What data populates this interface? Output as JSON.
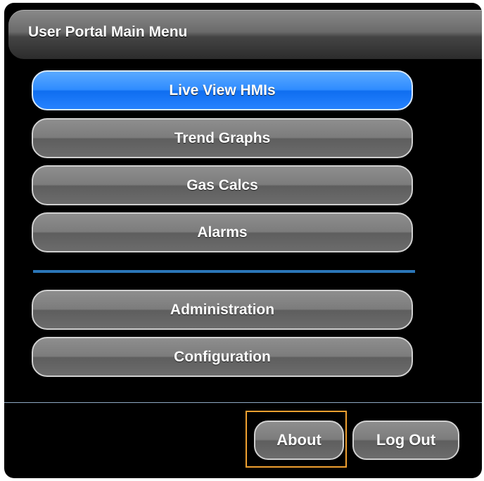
{
  "header": {
    "title": "User Portal Main Menu"
  },
  "menu": {
    "items": [
      {
        "label": "Live View HMIs",
        "active": true
      },
      {
        "label": "Trend Graphs",
        "active": false
      },
      {
        "label": "Gas Calcs",
        "active": false
      },
      {
        "label": "Alarms",
        "active": false
      },
      {
        "label": "Administration",
        "active": false
      },
      {
        "label": "Configuration",
        "active": false
      }
    ]
  },
  "footer": {
    "about_label": "About",
    "logout_label": "Log Out"
  },
  "colors": {
    "active_button": "#2f8cff",
    "divider": "#2b76b8",
    "focus_outline": "#f0a030"
  }
}
